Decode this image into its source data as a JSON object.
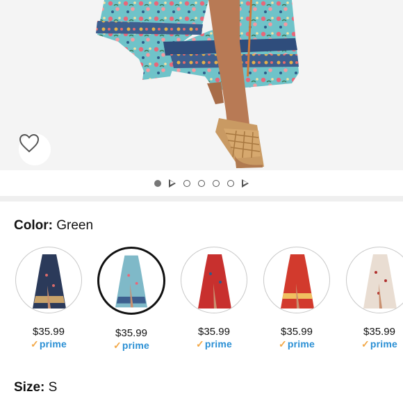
{
  "hero": {
    "image": "product-photo-floral-maxi-skirt-with-woven-sandal",
    "favorite_icon": "heart-outline-icon"
  },
  "carousel": {
    "indicators": [
      "dot-active",
      "video-play",
      "dot",
      "dot",
      "dot",
      "dot",
      "video-play"
    ]
  },
  "color": {
    "label": "Color:",
    "value": "Green"
  },
  "swatches": [
    {
      "price": "$35.99",
      "prime_label": "prime",
      "image_color": "#2b3a5a"
    },
    {
      "price": "$35.99",
      "prime_label": "prime",
      "image_color": "#7fb9c8",
      "selected": true
    },
    {
      "price": "$35.99",
      "prime_label": "prime",
      "image_color": "#c8302e"
    },
    {
      "price": "$35.99",
      "prime_label": "prime",
      "image_color": "#d23a2d"
    },
    {
      "price": "$35.99",
      "prime_label": "prime",
      "image_color": "#e9ddd2"
    }
  ],
  "size": {
    "label": "Size:",
    "value": "S"
  },
  "colors": {
    "prime_blue": "#2a8fd4",
    "prime_check": "#f3a847",
    "selected_border": "#111111"
  }
}
